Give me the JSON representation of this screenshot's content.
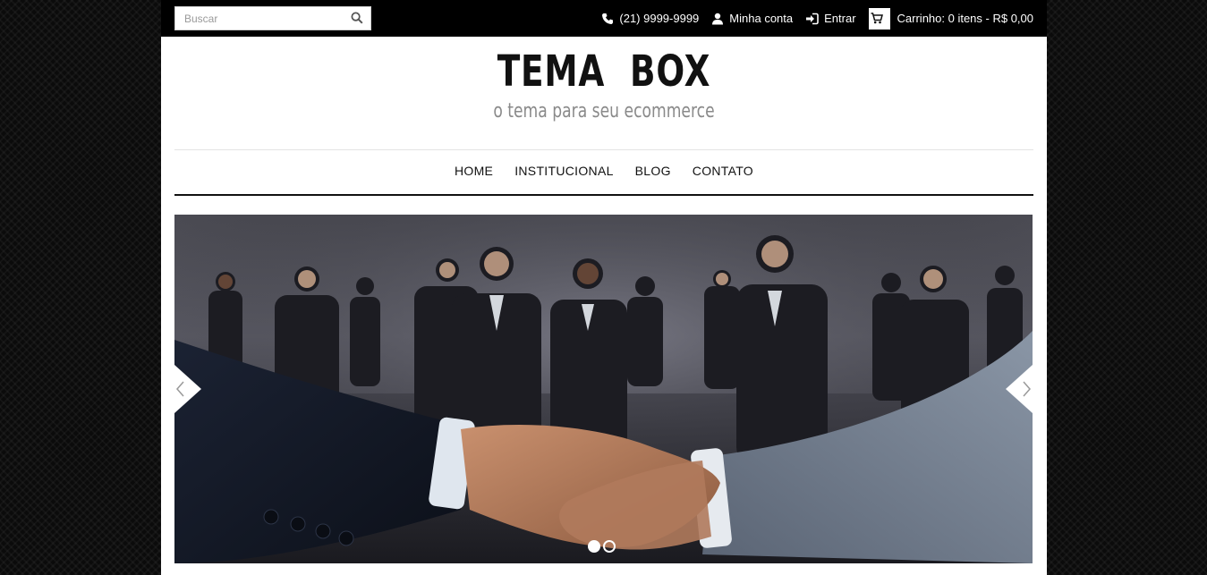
{
  "topbar": {
    "search": {
      "placeholder": "Buscar",
      "value": ""
    },
    "phone": "(21) 9999-9999",
    "account": "Minha conta",
    "login": "Entrar",
    "cart": "Carrinho: 0 itens - R$ 0,00",
    "icons": [
      "search-icon",
      "phone-icon",
      "user-icon",
      "login-icon",
      "cart-icon"
    ]
  },
  "header": {
    "logo": "TEMA BOX",
    "tagline": "o tema para seu ecommerce"
  },
  "nav": {
    "items": [
      "HOME",
      "INSTITUCIONAL",
      "BLOG",
      "CONTATO"
    ]
  },
  "slider": {
    "slide_count": 2,
    "active_slide": 1,
    "image_alt": "business people handshake"
  },
  "colors": {
    "background": "#0b0b0b",
    "topbar": "#000000",
    "text_dark": "#111111",
    "tagline": "#8a8a8a"
  }
}
